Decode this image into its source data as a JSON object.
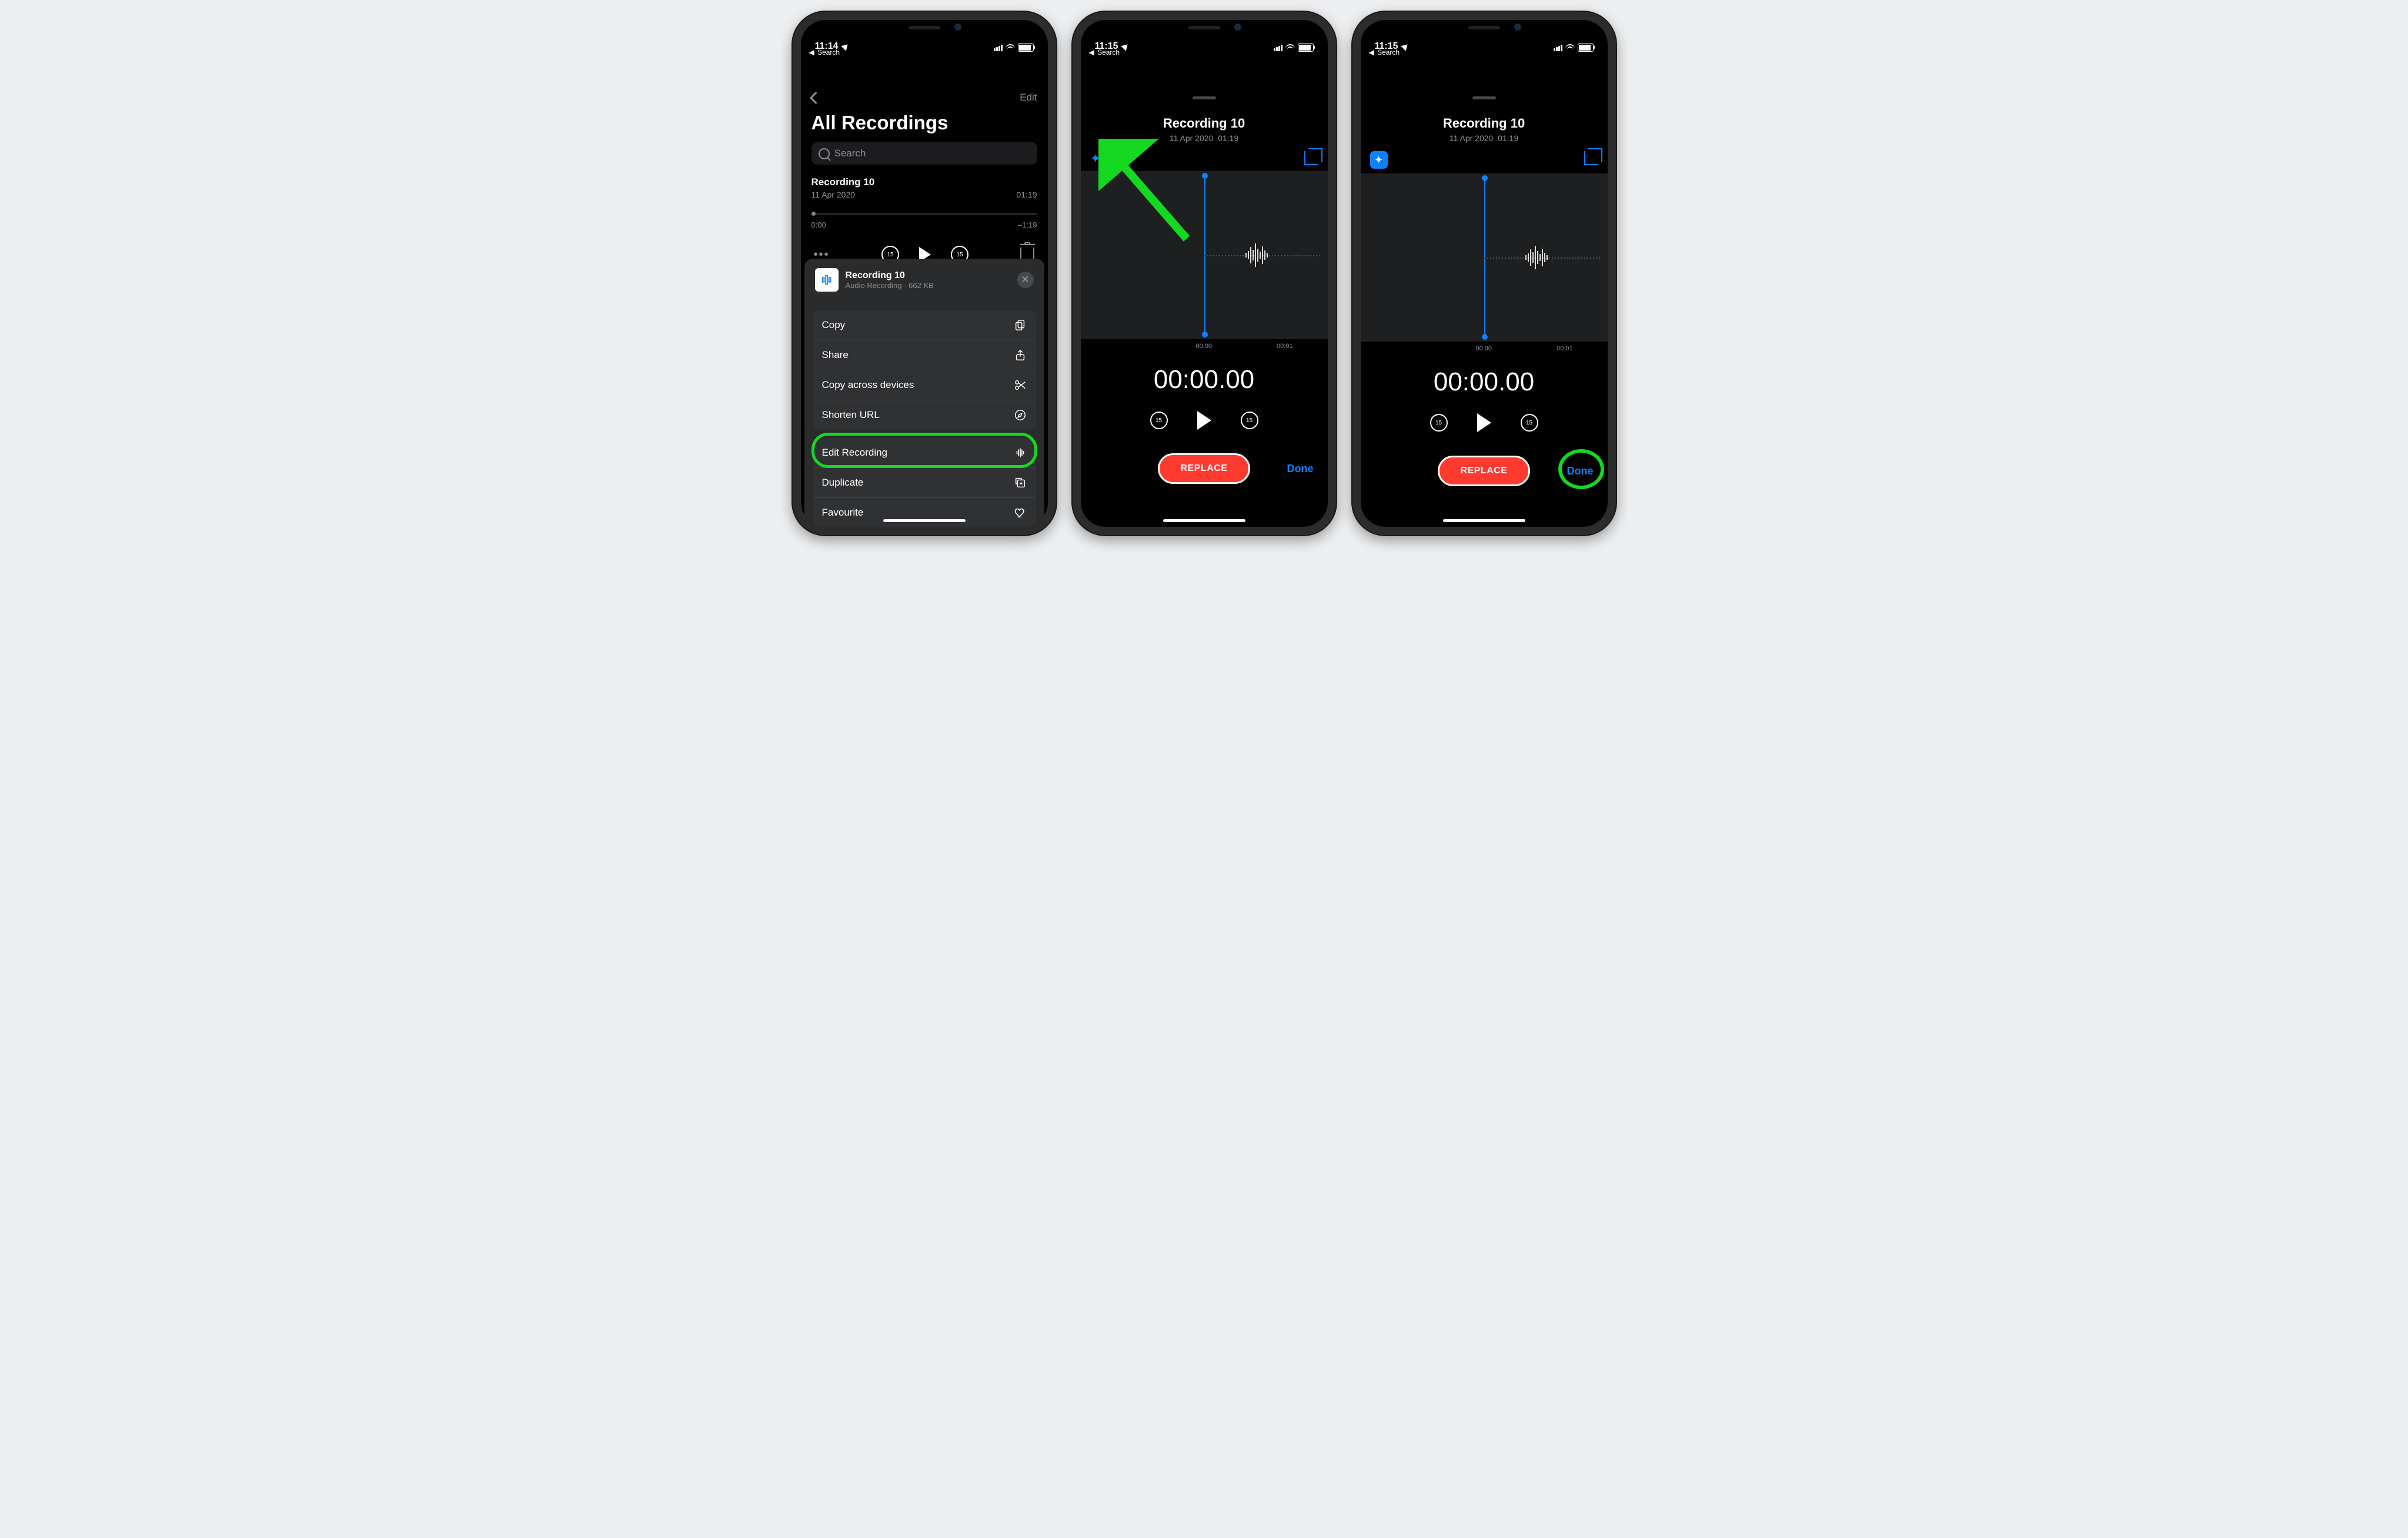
{
  "status": {
    "times": [
      "11:14",
      "11:15",
      "11:15"
    ],
    "back_label": "Search"
  },
  "s1": {
    "edit": "Edit",
    "title": "All Recordings",
    "search_placeholder": "Search",
    "recording": {
      "name": "Recording 10",
      "date": "11 Apr 2020",
      "duration": "01:19",
      "start": "0:00",
      "remaining": "–1:19"
    },
    "skip_seconds": "15",
    "sheet": {
      "title": "Recording 10",
      "subtitle": "Audio Recording · 662 KB",
      "actions": {
        "copy": "Copy",
        "share": "Share",
        "copy_across": "Copy across devices",
        "shorten": "Shorten URL",
        "edit": "Edit Recording",
        "duplicate": "Duplicate",
        "favourite": "Favourite"
      }
    }
  },
  "editor": {
    "title": "Recording 10",
    "sub_date": "11 Apr 2020",
    "sub_time": "01:19",
    "tick0": "00:00",
    "tick1": "00:01",
    "timer": "00:00.00",
    "skip_seconds": "15",
    "replace": "REPLACE",
    "done": "Done"
  }
}
